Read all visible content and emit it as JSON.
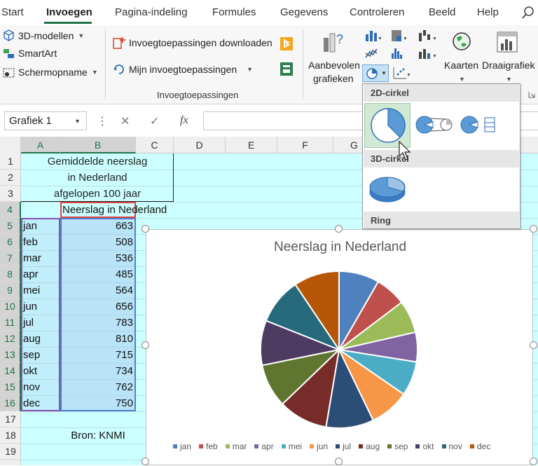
{
  "tabs": [
    "Start",
    "Invoegen",
    "Pagina-indeling",
    "Formules",
    "Gegevens",
    "Controleren",
    "Beeld",
    "Help"
  ],
  "active_tab": "Invoegen",
  "ribbon": {
    "models3d": "3D-modellen",
    "smartart": "SmartArt",
    "screenshot": "Schermopname",
    "addins_download": "Invoegtoepassingen downloaden",
    "my_addins": "Mijn invoegtoepassingen",
    "addins_group": "Invoegtoepassingen",
    "recommended_charts_line1": "Aanbevolen",
    "recommended_charts_line2": "grafieken",
    "maps": "Kaarten",
    "pivot_chart": "Draaigrafiek"
  },
  "formula_bar": {
    "name_box": "Grafiek 1",
    "formula": ""
  },
  "columns": [
    "A",
    "B",
    "C",
    "D",
    "E",
    "F",
    "G"
  ],
  "rows": [
    "1",
    "2",
    "3",
    "4",
    "5",
    "6",
    "7",
    "8",
    "9",
    "10",
    "11",
    "12",
    "13",
    "14",
    "15",
    "16",
    "17",
    "18",
    "19"
  ],
  "sheet": {
    "title_lines": [
      "Gemiddelde neerslag",
      "in Nederland",
      "afgelopen 100 jaar"
    ],
    "header_b4": "Neerslag in Nederland",
    "months": [
      "jan",
      "feb",
      "mar",
      "apr",
      "mei",
      "jun",
      "jul",
      "aug",
      "sep",
      "okt",
      "nov",
      "dec"
    ],
    "values": [
      "663",
      "508",
      "536",
      "485",
      "564",
      "656",
      "783",
      "810",
      "715",
      "734",
      "762",
      "750"
    ],
    "source": "Bron: KNMI"
  },
  "gallery": {
    "h2d": "2D-cirkel",
    "h3d": "3D-cirkel",
    "hring": "Ring"
  },
  "chart_data": {
    "type": "pie",
    "title": "Neerslag in Nederland",
    "categories": [
      "jan",
      "feb",
      "mar",
      "apr",
      "mei",
      "jun",
      "jul",
      "aug",
      "sep",
      "okt",
      "nov",
      "dec"
    ],
    "values": [
      663,
      508,
      536,
      485,
      564,
      656,
      783,
      810,
      715,
      734,
      762,
      750
    ],
    "colors": [
      "#4e81bd",
      "#c0504d",
      "#9bbb59",
      "#8064a2",
      "#4bacc6",
      "#f79646",
      "#2c4d75",
      "#772c2a",
      "#5f7530",
      "#4d3b62",
      "#276a7c",
      "#b65708"
    ],
    "legend_position": "bottom"
  }
}
